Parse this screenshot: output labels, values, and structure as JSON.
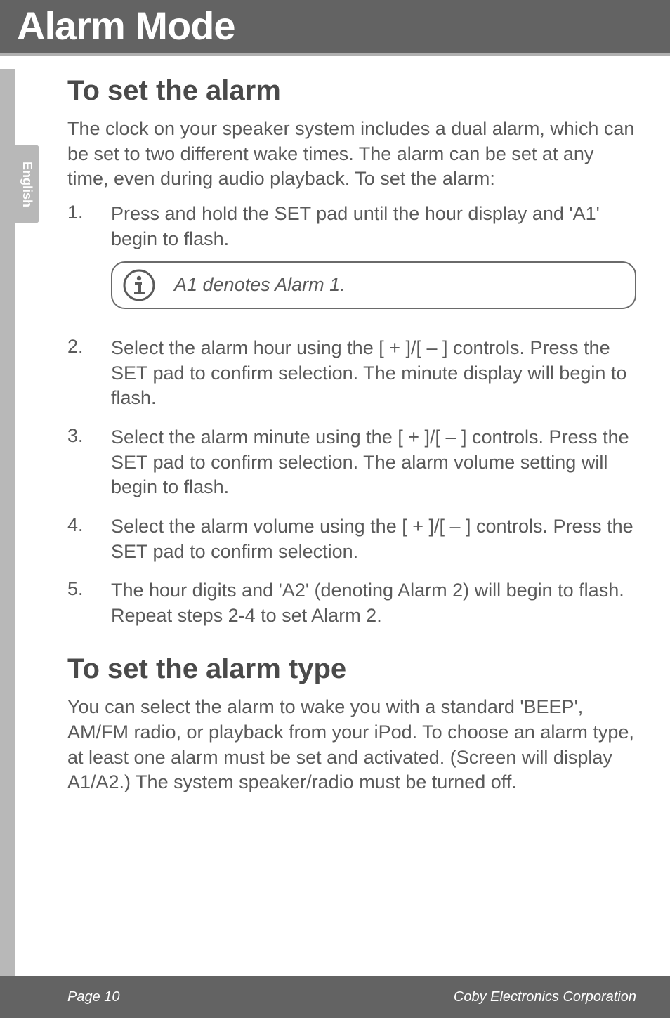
{
  "header": {
    "title": "Alarm Mode"
  },
  "side_tab": {
    "label": "English"
  },
  "sections": {
    "set_alarm": {
      "heading": "To set the alarm",
      "intro": "The clock on your speaker system includes a dual alarm, which can be set to two different wake times.  The alarm can be set at any time, even during audio playback. To set the alarm:",
      "steps": [
        {
          "num": "1.",
          "text": "Press and hold the SET pad until the hour display and 'A1' begin to flash."
        },
        {
          "num": "2.",
          "text": "Select the alarm hour using the [ + ]/[ – ] controls. Press the SET pad to confirm selection. The minute display will begin to flash."
        },
        {
          "num": "3.",
          "text": "Select the alarm minute using the [ + ]/[ – ] controls. Press the SET pad to confirm selection. The alarm volume setting will begin to flash."
        },
        {
          "num": "4.",
          "text": "Select the alarm volume using the [ + ]/[ – ] controls. Press the SET pad to confirm selection."
        },
        {
          "num": "5.",
          "text": "The hour digits and 'A2' (denoting Alarm 2) will begin to flash. Repeat steps 2-4 to set Alarm 2."
        }
      ],
      "info_note": "A1 denotes Alarm 1."
    },
    "set_alarm_type": {
      "heading": "To set the alarm type",
      "intro": "You can select the alarm to wake you with a standard 'BEEP',  AM/FM radio, or playback from your iPod. To choose an alarm type, at least one alarm must be set and activated. (Screen will display A1/A2.) The system speaker/radio must be turned off."
    }
  },
  "footer": {
    "page_label": "Page 10",
    "company": "Coby Electronics Corporation"
  }
}
